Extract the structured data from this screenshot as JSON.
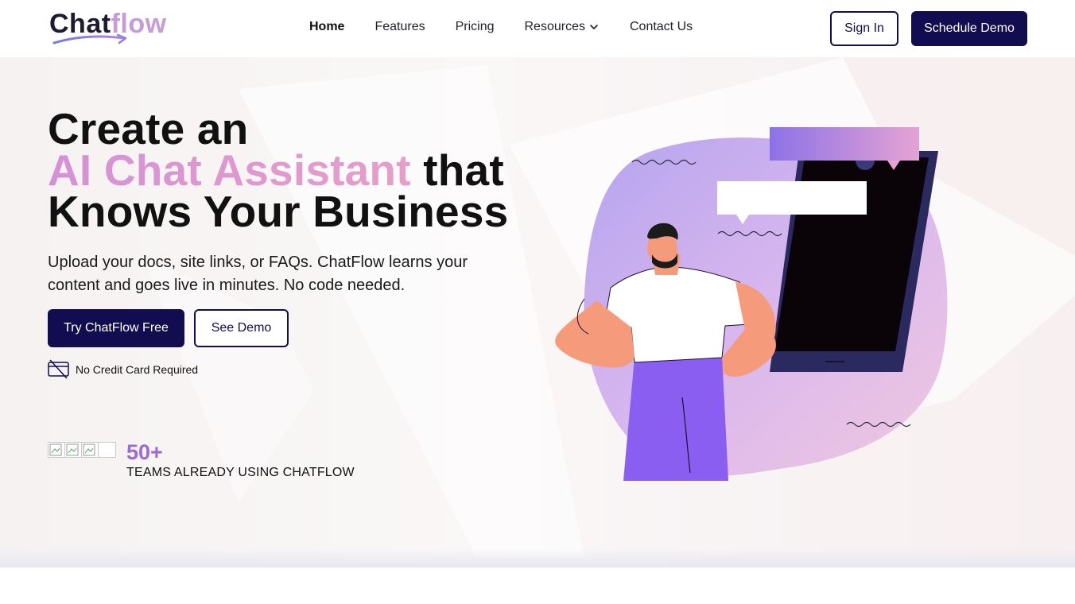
{
  "brand": {
    "name_part1": "Chat",
    "name_part2": "flow",
    "accent_color": "#c59bd8",
    "dark_color": "#110d50"
  },
  "nav": {
    "items": [
      {
        "label": "Home",
        "active": true
      },
      {
        "label": "Features",
        "active": false
      },
      {
        "label": "Pricing",
        "active": false
      },
      {
        "label": "Resources",
        "active": false,
        "has_dropdown": true,
        "icon": "chevron-down-icon"
      },
      {
        "label": "Contact Us",
        "active": false
      }
    ],
    "signin_label": "Sign In",
    "schedule_demo_label": "Schedule Demo"
  },
  "hero": {
    "headline_line1": "Create an",
    "headline_highlight": "AI Chat Assistant",
    "headline_line2_tail": " that",
    "headline_line3": "Knows Your Business",
    "subtitle": "Upload your docs, site links, or FAQs. ChatFlow learns your content and goes live in minutes. No code needed.",
    "primary_cta": "Try ChatFlow Free",
    "secondary_cta": "See Demo",
    "no_card_note": "No Credit Card Required",
    "no_card_icon": "no-card-icon",
    "social_proof": {
      "count": "50+",
      "label": "TEAMS ALREADY USING CHATFLOW",
      "avatar_count": 4
    }
  },
  "colors": {
    "gradient_start": "#d492d6",
    "gradient_end": "#e79ec8",
    "count_color": "#9a6ad6"
  }
}
